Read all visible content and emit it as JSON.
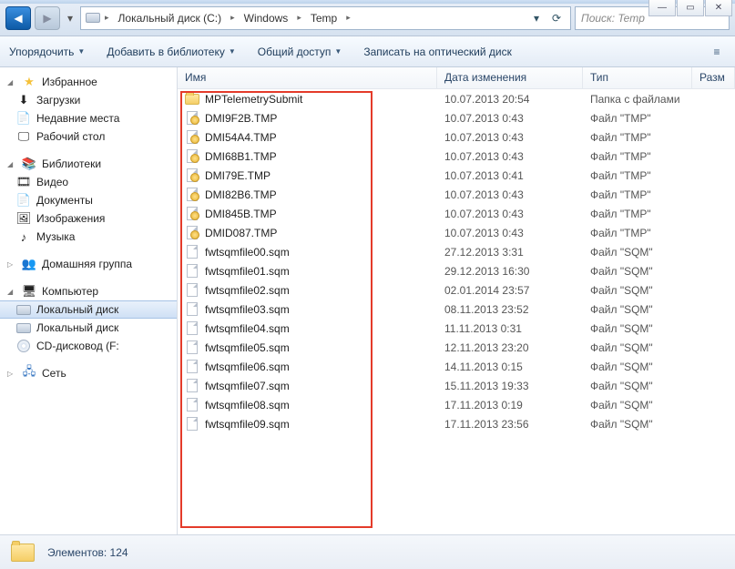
{
  "window_controls": {
    "min": "—",
    "max": "▭",
    "close": "✕"
  },
  "nav": {
    "back_glyph": "◀",
    "fwd_glyph": "▶",
    "dd_glyph": "▾",
    "refresh_glyph": "⟳"
  },
  "breadcrumbs": [
    "Локальный диск (C:)",
    "Windows",
    "Temp"
  ],
  "search_placeholder": "Поиск: Temp",
  "toolbar": {
    "organize": "Упорядочить",
    "add_lib": "Добавить в библиотеку",
    "share": "Общий доступ",
    "burn": "Записать на оптический диск"
  },
  "columns": {
    "name": "Имя",
    "date": "Дата изменения",
    "type": "Тип",
    "size": "Разм"
  },
  "sidebar": {
    "favorites": {
      "label": "Избранное",
      "items": [
        {
          "icon": "download-icon",
          "label": "Загрузки"
        },
        {
          "icon": "recent-icon",
          "label": "Недавние места"
        },
        {
          "icon": "desktop-icon",
          "label": "Рабочий стол"
        }
      ]
    },
    "libraries": {
      "label": "Библиотеки",
      "items": [
        {
          "icon": "video-icon",
          "label": "Видео"
        },
        {
          "icon": "documents-icon",
          "label": "Документы"
        },
        {
          "icon": "pictures-icon",
          "label": "Изображения"
        },
        {
          "icon": "music-icon",
          "label": "Музыка"
        }
      ]
    },
    "homegroup": {
      "label": "Домашняя группа"
    },
    "computer": {
      "label": "Компьютер",
      "items": [
        {
          "icon": "drive-icon",
          "label": "Локальный диск",
          "selected": true
        },
        {
          "icon": "drive-icon",
          "label": "Локальный диск"
        },
        {
          "icon": "cd-icon",
          "label": "CD-дисковод (F:"
        }
      ]
    },
    "network": {
      "label": "Сеть"
    }
  },
  "files": [
    {
      "icon": "folder",
      "name": "MPTelemetrySubmit",
      "date": "10.07.2013 20:54",
      "type": "Папка с файлами"
    },
    {
      "icon": "locked",
      "name": "DMI9F2B.TMP",
      "date": "10.07.2013 0:43",
      "type": "Файл \"TMP\""
    },
    {
      "icon": "locked",
      "name": "DMI54A4.TMP",
      "date": "10.07.2013 0:43",
      "type": "Файл \"TMP\""
    },
    {
      "icon": "locked",
      "name": "DMI68B1.TMP",
      "date": "10.07.2013 0:43",
      "type": "Файл \"TMP\""
    },
    {
      "icon": "locked",
      "name": "DMI79E.TMP",
      "date": "10.07.2013 0:41",
      "type": "Файл \"TMP\""
    },
    {
      "icon": "locked",
      "name": "DMI82B6.TMP",
      "date": "10.07.2013 0:43",
      "type": "Файл \"TMP\""
    },
    {
      "icon": "locked",
      "name": "DMI845B.TMP",
      "date": "10.07.2013 0:43",
      "type": "Файл \"TMP\""
    },
    {
      "icon": "locked",
      "name": "DMID087.TMP",
      "date": "10.07.2013 0:43",
      "type": "Файл \"TMP\""
    },
    {
      "icon": "page",
      "name": "fwtsqmfile00.sqm",
      "date": "27.12.2013 3:31",
      "type": "Файл \"SQM\""
    },
    {
      "icon": "page",
      "name": "fwtsqmfile01.sqm",
      "date": "29.12.2013 16:30",
      "type": "Файл \"SQM\""
    },
    {
      "icon": "page",
      "name": "fwtsqmfile02.sqm",
      "date": "02.01.2014 23:57",
      "type": "Файл \"SQM\""
    },
    {
      "icon": "page",
      "name": "fwtsqmfile03.sqm",
      "date": "08.11.2013 23:52",
      "type": "Файл \"SQM\""
    },
    {
      "icon": "page",
      "name": "fwtsqmfile04.sqm",
      "date": "11.11.2013 0:31",
      "type": "Файл \"SQM\""
    },
    {
      "icon": "page",
      "name": "fwtsqmfile05.sqm",
      "date": "12.11.2013 23:20",
      "type": "Файл \"SQM\""
    },
    {
      "icon": "page",
      "name": "fwtsqmfile06.sqm",
      "date": "14.11.2013 0:15",
      "type": "Файл \"SQM\""
    },
    {
      "icon": "page",
      "name": "fwtsqmfile07.sqm",
      "date": "15.11.2013 19:33",
      "type": "Файл \"SQM\""
    },
    {
      "icon": "page",
      "name": "fwtsqmfile08.sqm",
      "date": "17.11.2013 0:19",
      "type": "Файл \"SQM\""
    },
    {
      "icon": "page",
      "name": "fwtsqmfile09.sqm",
      "date": "17.11.2013 23:56",
      "type": "Файл \"SQM\""
    }
  ],
  "status": {
    "label": "Элементов:",
    "count": "124"
  }
}
